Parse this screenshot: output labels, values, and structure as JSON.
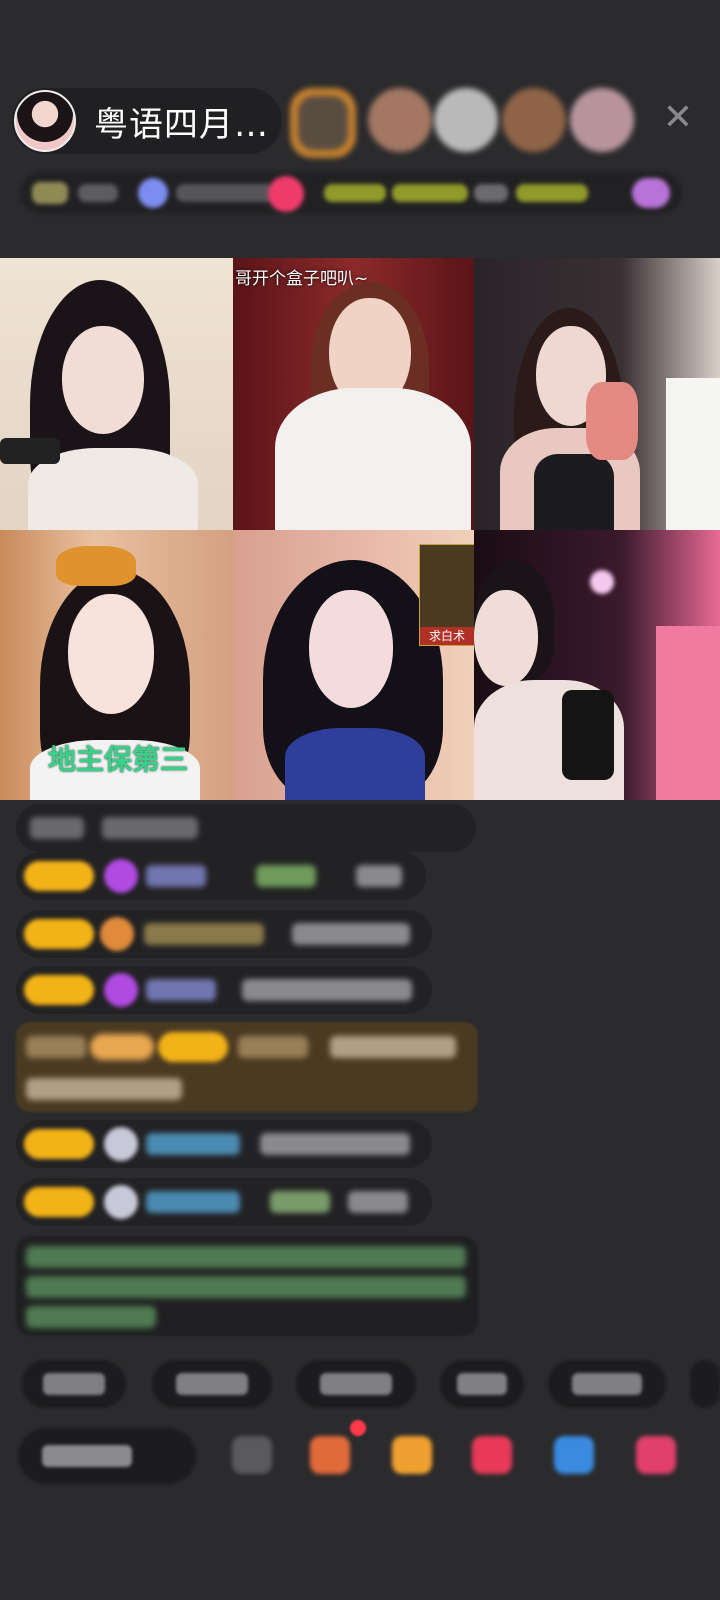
{
  "header": {
    "room_title": "粤语四月…",
    "close_icon_char": "✕"
  },
  "grid": {
    "cell_2_overlay": "哥开个盒子吧叭~",
    "cell_4_overlay": "地主保第三",
    "gift_label": "求白术"
  },
  "colors": {
    "background": "#2b2b2d",
    "badge_gold": "#f2b317",
    "overlay_green": "#39d08a"
  }
}
